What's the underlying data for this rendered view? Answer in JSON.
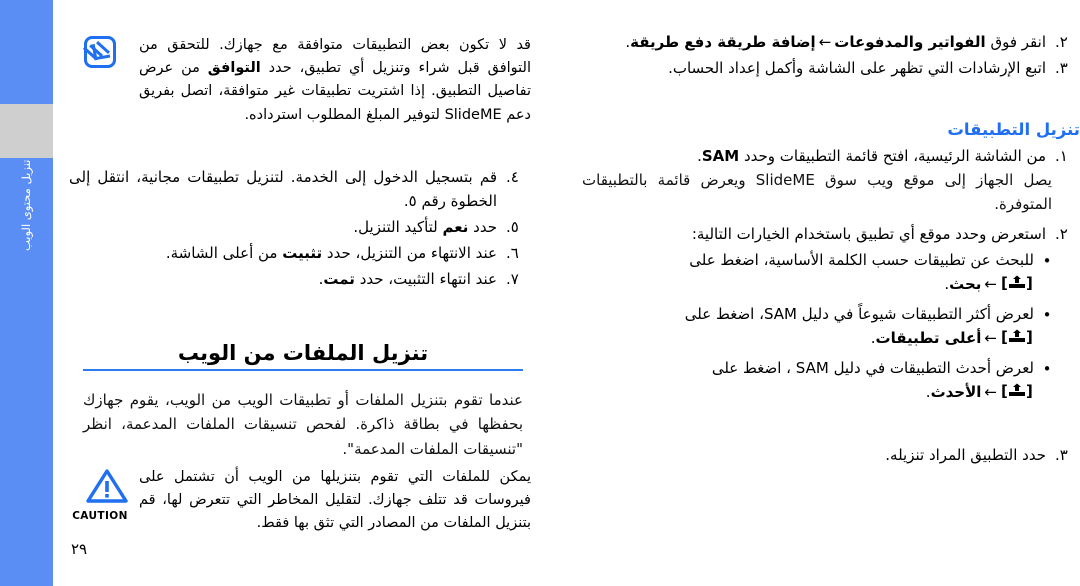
{
  "side_tab": {
    "label": "تنزيل محتوى الويب",
    "color": "#5b8ef4",
    "gray_color": "#cfcfcf"
  },
  "colors": {
    "accent_blue": "#1f6ff0",
    "rule_blue": "#2b7bf3",
    "icon_blue": "#1f6ff0"
  },
  "page_number": "٢٩",
  "left_column": {
    "note": {
      "icon": "note-pencil-icon",
      "text_part1": "قد لا تكون بعض التطبيقات متوافقة مع جهازك. للتحقق من التوافق قبل شراء وتنزيل أي تطبيق، حدد ",
      "text_bold1": "التوافق",
      "text_part2": " من عرض تفاصيل التطبيق. إذا اشتريت تطبيقات غير متوافقة، اتصل بفريق دعم SlideME لتوفير المبلغ المطلوب استرداده."
    },
    "steps": [
      {
        "marker": "٤.",
        "text": "قم بتسجيل الدخول إلى الخدمة. لتنزيل تطبيقات مجانية، انتقل إلى الخطوة رقم ٥."
      },
      {
        "marker": "٥.",
        "text_prefix": "حدد ",
        "bold": "نعم",
        "text_suffix": " لتأكيد التنزيل."
      },
      {
        "marker": "٦.",
        "text_prefix": "عند الانتهاء من التنزيل، حدد ",
        "bold": "تثبيت",
        "text_suffix": " من أعلى الشاشة."
      },
      {
        "marker": "٧.",
        "text_prefix": "عند انتهاء التثبيت، حدد ",
        "bold": "تمت",
        "text_suffix": "."
      }
    ],
    "web_section": {
      "heading": "تنزيل الملفات من الويب",
      "paragraph": "عندما تقوم بتنزيل الملفات أو تطبيقات الويب من الويب، يقوم جهازك بحفظها في بطاقة ذاكرة. لفحص تنسيقات الملفات المدعمة، انظر \"تنسيقات الملفات المدعمة\"."
    },
    "caution": {
      "icon": "caution-triangle-icon",
      "icon_label": "CAUTION",
      "text": "يمكن للملفات التي تقوم بتنزيلها من الويب أن تشتمل على فيروسات قد تتلف جهازك. لتقليل المخاطر التي تتعرض لها، قم بتنزيل الملفات من المصادر التي تثق بها فقط."
    }
  },
  "right_column": {
    "top_steps": [
      {
        "marker": "٢.",
        "text_prefix": "انقر فوق ",
        "bold1": "الفواتير والمدفوعات",
        "arrow": "←",
        "bold2": "إضافة طريقة دفع طريقة",
        "text_suffix": "."
      },
      {
        "marker": "٣.",
        "text": "اتبع الإرشادات التي تظهر على الشاشة وأكمل إعداد الحساب."
      }
    ],
    "apps_heading": "تنزيل التطبيقات",
    "step1": {
      "marker": "١.",
      "text_prefix": "من الشاشة الرئيسية، افتح قائمة التطبيقات وحدد ",
      "bold": "SAM",
      "text_suffix": "."
    },
    "step1_sub": "يصل الجهاز إلى موقع ويب سوق SlideME ويعرض قائمة بالتطبيقات المتوفرة.",
    "step2": {
      "marker": "٢.",
      "text": "استعرض وحدد موقع أي تطبيق باستخدام الخيارات التالية:"
    },
    "bullets": [
      {
        "text": "للبحث عن تطبيقات حسب الكلمة الأساسية، اضغط على",
        "key_icon": "menu-key-bracket-icon",
        "arrow": "←",
        "bold": "بحث",
        "suffix": "."
      },
      {
        "text": "لعرض أكثر التطبيقات شيوعاً في دليل SAM، اضغط على",
        "key_icon": "menu-key-bracket-icon",
        "arrow": "←",
        "bold": "أعلى تطبيقات",
        "suffix": "."
      },
      {
        "text": "لعرض أحدث التطبيقات في دليل SAM ، اضغط على",
        "key_icon": "menu-key-bracket-icon",
        "arrow": "←",
        "bold": "الأحدث",
        "suffix": "."
      }
    ],
    "step3": {
      "marker": "٣.",
      "text": "حدد التطبيق المراد تنزيله."
    }
  }
}
